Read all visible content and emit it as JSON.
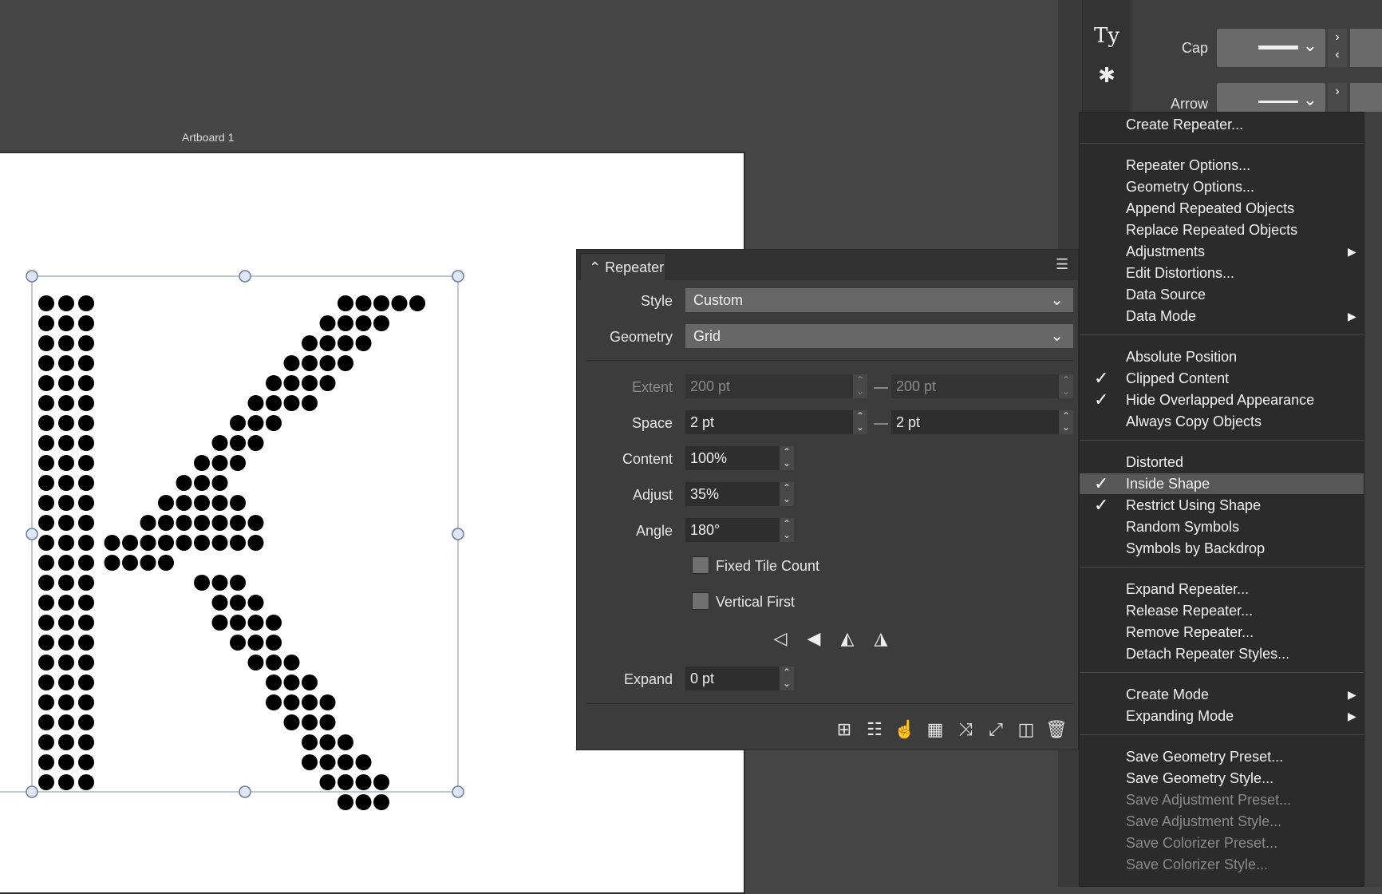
{
  "canvas": {
    "artboard_label": "Artboard 1"
  },
  "toolstrip": {
    "icons": [
      "text-style-icon",
      "asterisk-symbol-icon"
    ],
    "type_glyph": "Ty",
    "symbol_glyph": "✱"
  },
  "stroke_panel": {
    "cap_label": "Cap",
    "arrow_label": "Arrow"
  },
  "repeater": {
    "tab_label": "Repeater",
    "style_label": "Style",
    "style_value": "Custom",
    "geometry_label": "Geometry",
    "geometry_value": "Grid",
    "extent_label": "Extent",
    "extent_x": "200 pt",
    "extent_y": "200 pt",
    "space_label": "Space",
    "space_x": "2 pt",
    "space_y": "2 pt",
    "content_label": "Content",
    "content_value": "100%",
    "adjust_label": "Adjust",
    "adjust_value": "35%",
    "angle_label": "Angle",
    "angle_value": "180°",
    "fixed_tile_count_label": "Fixed Tile Count",
    "fixed_tile_count_checked": false,
    "vertical_first_label": "Vertical First",
    "vertical_first_checked": false,
    "expand_label": "Expand",
    "expand_value": "0 pt"
  },
  "context_menu": {
    "groups": [
      [
        {
          "label": "Create Repeater...",
          "checked": false,
          "submenu": false,
          "disabled": false
        }
      ],
      [
        {
          "label": "Repeater Options...",
          "checked": false,
          "submenu": false,
          "disabled": false
        },
        {
          "label": "Geometry Options...",
          "checked": false,
          "submenu": false,
          "disabled": false
        },
        {
          "label": "Append Repeated Objects",
          "checked": false,
          "submenu": false,
          "disabled": false
        },
        {
          "label": "Replace Repeated Objects",
          "checked": false,
          "submenu": false,
          "disabled": false
        },
        {
          "label": "Adjustments",
          "checked": false,
          "submenu": true,
          "disabled": false
        },
        {
          "label": "Edit Distortions...",
          "checked": false,
          "submenu": false,
          "disabled": false
        },
        {
          "label": "Data Source",
          "checked": false,
          "submenu": false,
          "disabled": false
        },
        {
          "label": "Data Mode",
          "checked": false,
          "submenu": true,
          "disabled": false
        }
      ],
      [
        {
          "label": "Absolute Position",
          "checked": false,
          "submenu": false,
          "disabled": false
        },
        {
          "label": "Clipped Content",
          "checked": true,
          "submenu": false,
          "disabled": false
        },
        {
          "label": "Hide Overlapped Appearance",
          "checked": true,
          "submenu": false,
          "disabled": false
        },
        {
          "label": "Always Copy Objects",
          "checked": false,
          "submenu": false,
          "disabled": false
        }
      ],
      [
        {
          "label": "Distorted",
          "checked": false,
          "submenu": false,
          "disabled": false
        },
        {
          "label": "Inside Shape",
          "checked": true,
          "submenu": false,
          "disabled": false,
          "highlighted": true
        },
        {
          "label": "Restrict Using Shape",
          "checked": true,
          "submenu": false,
          "disabled": false
        },
        {
          "label": "Random Symbols",
          "checked": false,
          "submenu": false,
          "disabled": false
        },
        {
          "label": "Symbols by Backdrop",
          "checked": false,
          "submenu": false,
          "disabled": false
        }
      ],
      [
        {
          "label": "Expand Repeater...",
          "checked": false,
          "submenu": false,
          "disabled": false
        },
        {
          "label": "Release Repeater...",
          "checked": false,
          "submenu": false,
          "disabled": false
        },
        {
          "label": "Remove Repeater...",
          "checked": false,
          "submenu": false,
          "disabled": false
        },
        {
          "label": "Detach Repeater Styles...",
          "checked": false,
          "submenu": false,
          "disabled": false
        }
      ],
      [
        {
          "label": "Create Mode",
          "checked": false,
          "submenu": true,
          "disabled": false
        },
        {
          "label": "Expanding Mode",
          "checked": false,
          "submenu": true,
          "disabled": false
        }
      ],
      [
        {
          "label": "Save Geometry Preset...",
          "checked": false,
          "submenu": false,
          "disabled": false
        },
        {
          "label": "Save Geometry Style...",
          "checked": false,
          "submenu": false,
          "disabled": false
        },
        {
          "label": "Save Adjustment Preset...",
          "checked": false,
          "submenu": false,
          "disabled": true
        },
        {
          "label": "Save Adjustment Style...",
          "checked": false,
          "submenu": false,
          "disabled": true
        },
        {
          "label": "Save Colorizer Preset...",
          "checked": false,
          "submenu": false,
          "disabled": true
        },
        {
          "label": "Save Colorizer Style...",
          "checked": false,
          "submenu": false,
          "disabled": true
        }
      ]
    ]
  }
}
